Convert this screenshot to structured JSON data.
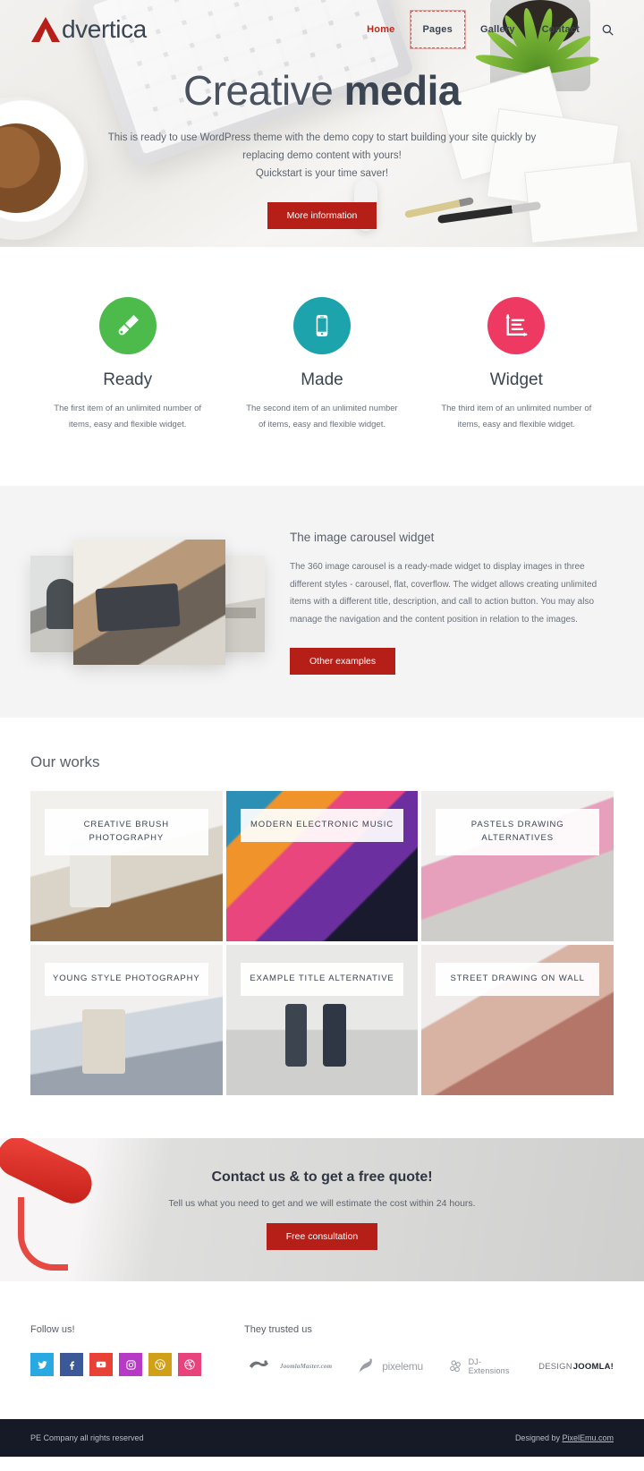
{
  "site": {
    "logo_text": "dvertica",
    "logo_initial": "A"
  },
  "nav": {
    "items": [
      {
        "label": "Home",
        "state": "active"
      },
      {
        "label": "Pages",
        "state": "focused"
      },
      {
        "label": "Gallery",
        "state": "normal"
      },
      {
        "label": "Contact",
        "state": "normal"
      }
    ],
    "search_icon": "search-icon"
  },
  "hero": {
    "title_light": "Creative",
    "title_bold": "media",
    "subtitle_line1": "This is ready to use WordPress theme with the demo copy to start building your site quickly by replacing",
    "subtitle_line2": "demo content with yours!",
    "subtitle_line3": "Quickstart is your time saver!",
    "button_label": "More information"
  },
  "features": [
    {
      "icon": "paint-brush-icon",
      "color": "#4cbb4c",
      "title": "Ready",
      "text": "The first item of an unlimited number of items, easy and flexible widget."
    },
    {
      "icon": "mobile-phone-icon",
      "color": "#1ca3ac",
      "title": "Made",
      "text": "The second item of an unlimited number of items, easy and flexible widget."
    },
    {
      "icon": "bar-chart-icon",
      "color": "#ee3a63",
      "title": "Widget",
      "text": "The third item of an unlimited number of items, easy and flexible widget."
    }
  ],
  "carousel": {
    "heading": "The image carousel widget",
    "text": "The 360 image carousel is a ready-made widget to display images in three different styles - carousel, flat, coverflow. The widget allows creating unlimited items with a different title, description, and call to action button. You may also manage the navigation and the content position in relation to the images.",
    "button_label": "Other examples"
  },
  "works": {
    "heading": "Our works",
    "items": [
      {
        "title": "CREATIVE BRUSH PHOTOGRAPHY"
      },
      {
        "title": "MODERN ELECTRONIC MUSIC"
      },
      {
        "title": "PASTELS DRAWING ALTERNATIVES"
      },
      {
        "title": "YOUNG STYLE PHOTOGRAPHY"
      },
      {
        "title": "EXAMPLE TITLE ALTERNATIVE"
      },
      {
        "title": "STREET DRAWING ON WALL"
      }
    ]
  },
  "cta": {
    "heading": "Contact us & to get a free quote!",
    "text": "Tell us what you need to get and we will estimate the cost within 24 hours.",
    "button_label": "Free consultation"
  },
  "footer": {
    "follow_heading": "Follow us!",
    "socials": [
      {
        "name": "twitter-icon",
        "color": "#29a9e1"
      },
      {
        "name": "facebook-icon",
        "color": "#3b5998"
      },
      {
        "name": "youtube-icon",
        "color": "#e84136"
      },
      {
        "name": "instagram-icon",
        "color": "#b63ac6"
      },
      {
        "name": "wordpress-icon",
        "color": "#cfa018"
      },
      {
        "name": "dribbble-icon",
        "color": "#e8437c"
      }
    ],
    "trusted_heading": "They trusted us",
    "brands": [
      {
        "name": "JoomlaMaster.com",
        "style": "script"
      },
      {
        "name": "pixelemu",
        "style": "emu"
      },
      {
        "name": "DJ-Extensions",
        "style": "plain"
      },
      {
        "name_light": "DESIGN",
        "name_bold": "JOOMLA!",
        "style": "split"
      }
    ]
  },
  "bottom": {
    "copyright": "PE Company all rights reserved",
    "designed_prefix": "Designed by ",
    "designed_link": "PixelEmu.com"
  },
  "colors": {
    "accent_red": "#b51f18",
    "nav_active": "#c3271b",
    "dark": "#151a26"
  }
}
